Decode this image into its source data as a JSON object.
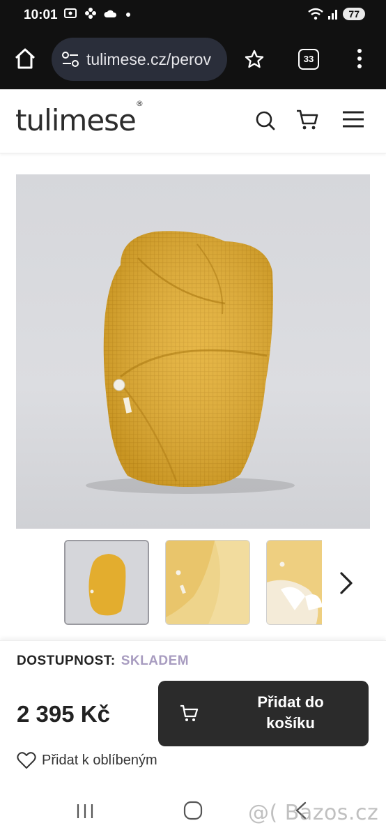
{
  "status_bar": {
    "time": "10:01",
    "battery": "77",
    "icons": [
      "screenshot-icon",
      "flower-icon",
      "cloud-icon",
      "dot-icon",
      "wifi-icon",
      "signal-icon",
      "battery-icon"
    ]
  },
  "browser": {
    "url": "tulimese.cz/perov",
    "tab_count": "33"
  },
  "site": {
    "logo": "tulimese",
    "logo_mark": "®"
  },
  "availability": {
    "label": "DOSTUPNOST:",
    "value": "SKLADEM"
  },
  "price": "2 395 Kč",
  "add_to_cart": {
    "line1": "Přidat do",
    "line2": "košíku"
  },
  "favorite_label": "Přidat k oblíbeným",
  "watermark": "@( Bazos.cz",
  "colors": {
    "product": "#e3ad2e",
    "accent_availability": "#a89cc0",
    "button_dark": "#2b2b2b",
    "system_bar": "#111111"
  }
}
